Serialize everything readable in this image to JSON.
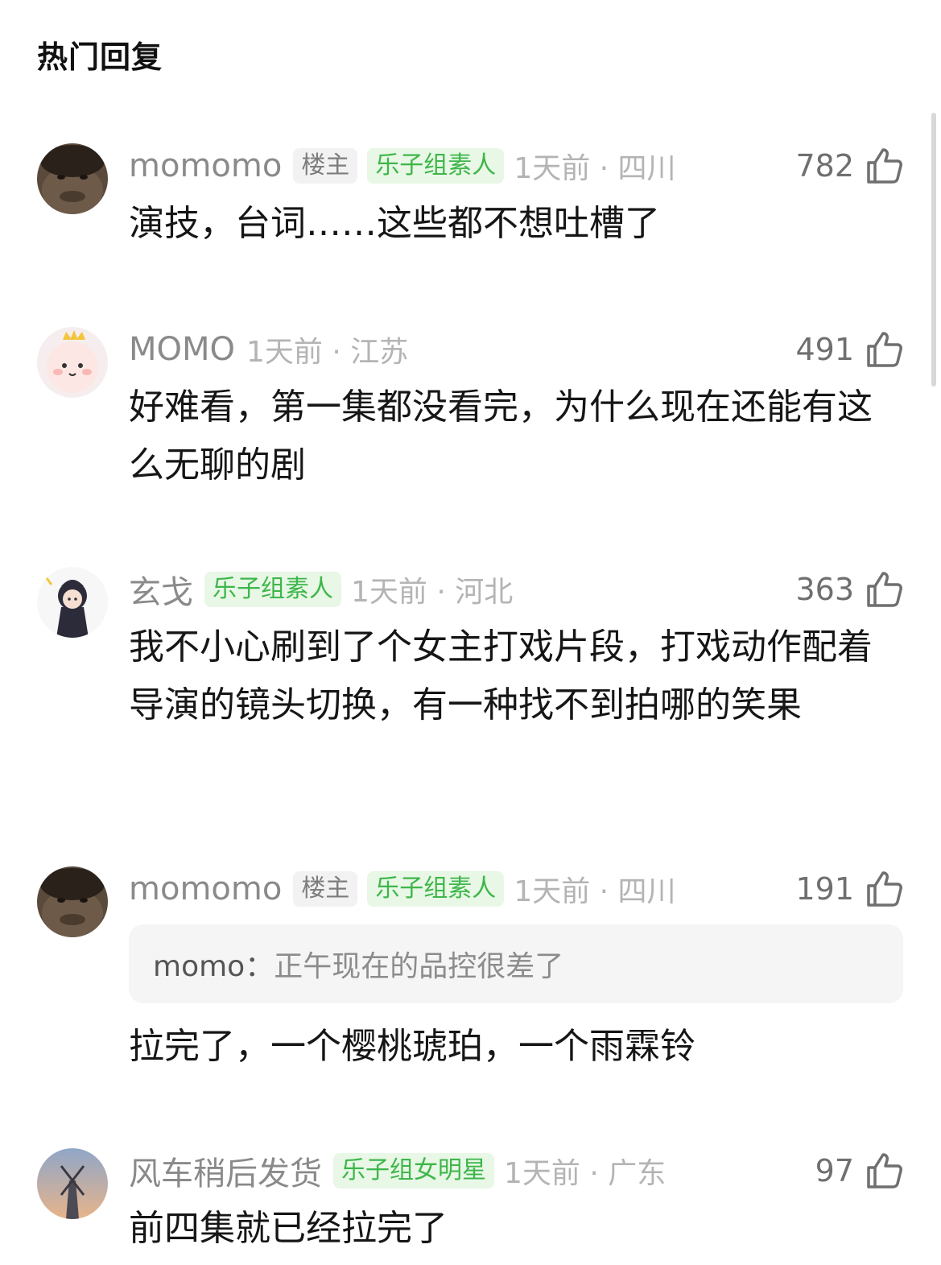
{
  "section_title": "热门回复",
  "comments": [
    {
      "username": "momomo",
      "badges": [
        "楼主",
        "乐子组素人"
      ],
      "time_location": "1天前 · 四川",
      "likes": "782",
      "text": "演技，台词……这些都不想吐槽了"
    },
    {
      "username": "MOMO",
      "badges": [],
      "time_location": "1天前 · 江苏",
      "likes": "491",
      "text": "好难看，第一集都没看完，为什么现在还能有这么无聊的剧"
    },
    {
      "username": "玄戈",
      "badges": [
        "乐子组素人"
      ],
      "time_location": "1天前 · 河北",
      "likes": "363",
      "text": "我不小心刷到了个女主打戏片段，打戏动作配着导演的镜头切换，有一种找不到拍哪的笑果"
    },
    {
      "username": "momomo",
      "badges": [
        "楼主",
        "乐子组素人"
      ],
      "time_location": "1天前 · 四川",
      "likes": "191",
      "quote": {
        "author": "momo：",
        "text": "正午现在的品控很差了"
      },
      "text": "拉完了，一个樱桃琥珀，一个雨霖铃"
    },
    {
      "username": "风车稍后发货",
      "badges": [
        "乐子组女明星"
      ],
      "time_location": "1天前 · 广东",
      "likes": "97",
      "text": "前四集就已经拉完了"
    }
  ],
  "colors": {
    "group_badge_text": "#3eb64a",
    "group_badge_bg": "#e8f7e6",
    "op_badge_bg": "#f2f2f2",
    "meta_gray": "#b4b4b4"
  }
}
